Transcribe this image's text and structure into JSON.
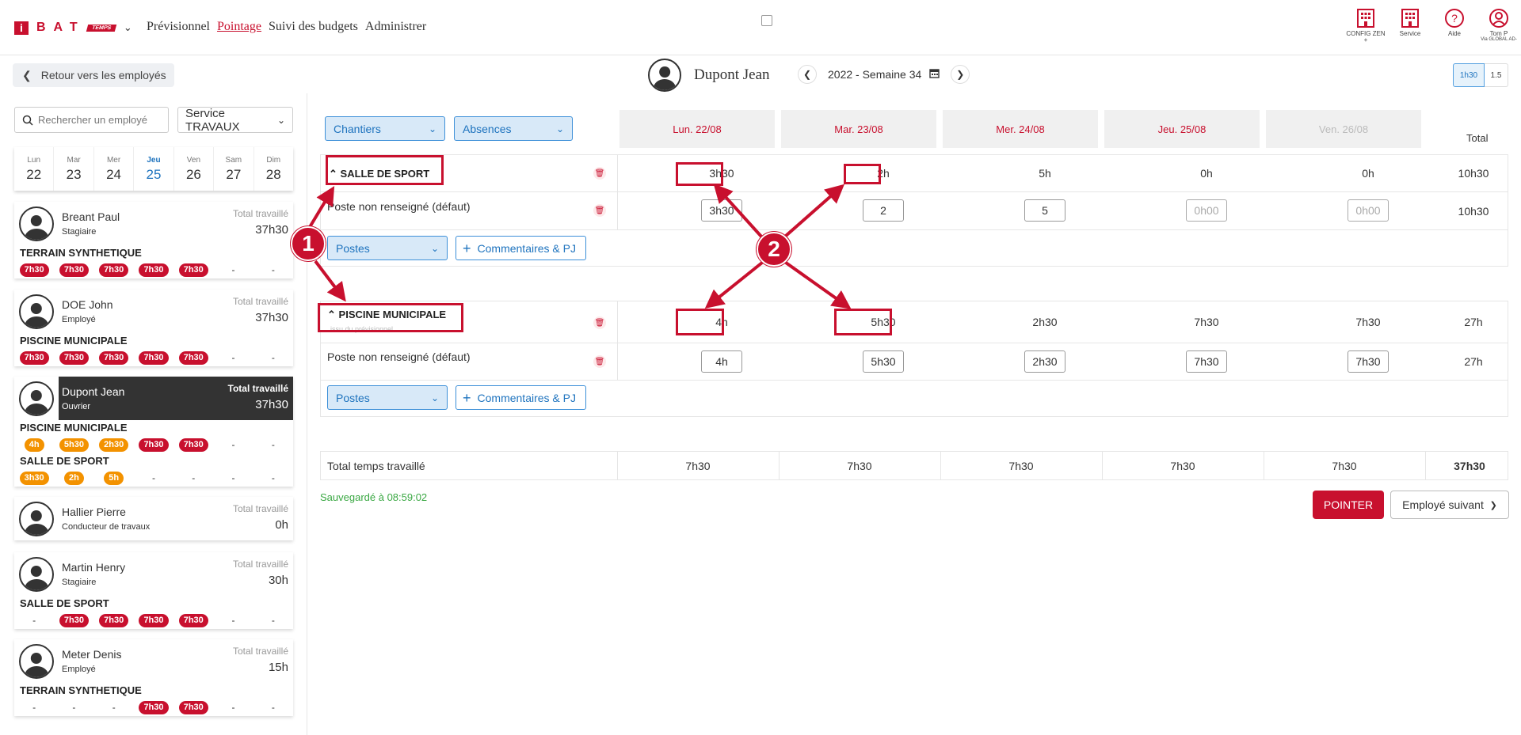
{
  "brand": {
    "i": "i",
    "bat": "BAT",
    "temps": "TEMPS"
  },
  "nav": [
    {
      "label": "Prévisionnel"
    },
    {
      "label": "Pointage"
    },
    {
      "label": "Suivi des budgets"
    },
    {
      "label": "Administrer"
    }
  ],
  "top_icons": [
    {
      "label": "CONFIG ZEN +",
      "icon": "building-icon"
    },
    {
      "label": "Service",
      "icon": "building-icon"
    },
    {
      "label": "Aide",
      "icon": "help-icon"
    },
    {
      "label": "Tom P",
      "sub": "Via GLOBAL AD-",
      "icon": "user-icon"
    }
  ],
  "back_label": "Retour vers les employés",
  "employee_name": "Dupont Jean",
  "week_label": "2022 - Semaine 34",
  "toggle": {
    "on": "1h30",
    "off": "1.5"
  },
  "search_placeholder": "Rechercher un employé",
  "service_select": "Service TRAVAUX",
  "days": [
    {
      "name": "Lun",
      "num": "22"
    },
    {
      "name": "Mar",
      "num": "23"
    },
    {
      "name": "Mer",
      "num": "24"
    },
    {
      "name": "Jeu",
      "num": "25"
    },
    {
      "name": "Ven",
      "num": "26"
    },
    {
      "name": "Sam",
      "num": "27"
    },
    {
      "name": "Dim",
      "num": "28"
    }
  ],
  "total_label": "Total travaillé",
  "employees": [
    {
      "name": "Breant Paul",
      "role": "Stagiaire",
      "total": "37h30",
      "sites": [
        {
          "name": "TERRAIN SYNTHETIQUE",
          "cells": [
            "7h30",
            "7h30",
            "7h30",
            "7h30",
            "7h30",
            "-",
            "-"
          ],
          "color": "red"
        }
      ]
    },
    {
      "name": "DOE John",
      "role": "Employé",
      "total": "37h30",
      "sites": [
        {
          "name": "PISCINE MUNICIPALE",
          "cells": [
            "7h30",
            "7h30",
            "7h30",
            "7h30",
            "7h30",
            "-",
            "-"
          ],
          "color": "red"
        }
      ]
    },
    {
      "name": "Dupont Jean",
      "role": "Ouvrier",
      "total": "37h30",
      "sites": [
        {
          "name": "PISCINE MUNICIPALE",
          "cells": [
            "4h",
            "5h30",
            "2h30",
            "7h30",
            "7h30",
            "-",
            "-"
          ],
          "colors": [
            "orange",
            "orange",
            "orange",
            "red",
            "red"
          ]
        },
        {
          "name": "SALLE DE SPORT",
          "cells": [
            "3h30",
            "2h",
            "5h",
            "-",
            "-",
            "-",
            "-"
          ],
          "color": "orange"
        }
      ]
    },
    {
      "name": "Hallier Pierre",
      "role": "Conducteur de travaux",
      "total": "0h",
      "sites": []
    },
    {
      "name": "Martin Henry",
      "role": "Stagiaire",
      "total": "30h",
      "sites": [
        {
          "name": "SALLE DE SPORT",
          "cells": [
            "-",
            "7h30",
            "7h30",
            "7h30",
            "7h30",
            "-",
            "-"
          ],
          "color": "red"
        }
      ]
    },
    {
      "name": "Meter Denis",
      "role": "Employé",
      "total": "15h",
      "sites": [
        {
          "name": "TERRAIN SYNTHETIQUE",
          "cells": [
            "-",
            "-",
            "-",
            "7h30",
            "7h30",
            "-",
            "-"
          ],
          "color": "red"
        }
      ]
    }
  ],
  "filters": {
    "chantiers": "Chantiers",
    "absences": "Absences"
  },
  "day_headers": [
    "Lun. 22/08",
    "Mar. 23/08",
    "Mer. 24/08",
    "Jeu. 25/08",
    "Ven. 26/08"
  ],
  "total_header": "Total",
  "blocks": [
    {
      "title": "SALLE DE SPORT",
      "subtitle": "",
      "values": [
        "3h30",
        "2h",
        "5h",
        "0h",
        "0h"
      ],
      "total": "10h30",
      "poste_label": "Poste non renseigné (défaut)",
      "inputs": [
        "3h30",
        "2",
        "5",
        "",
        ""
      ],
      "input_placeholder": "0h00",
      "poste_total": "10h30"
    },
    {
      "title": "PISCINE MUNICIPALE",
      "subtitle": "issu du prévisionnel",
      "values": [
        "4h",
        "5h30",
        "2h30",
        "7h30",
        "7h30"
      ],
      "total": "27h",
      "poste_label": "Poste non renseigné (défaut)",
      "inputs": [
        "4h",
        "5h30",
        "2h30",
        "7h30",
        "7h30"
      ],
      "input_placeholder": "0h00",
      "poste_total": "27h"
    }
  ],
  "postes_label": "Postes",
  "comments_label": "Commentaires & PJ",
  "total_row": {
    "label": "Total temps travaillé",
    "values": [
      "7h30",
      "7h30",
      "7h30",
      "7h30",
      "7h30"
    ],
    "total": "37h30"
  },
  "saved_text": "Sauvegardé à 08:59:02",
  "pointer_label": "POINTER",
  "next_label": "Employé suivant",
  "annotations": [
    {
      "label": "1"
    },
    {
      "label": "2"
    }
  ],
  "colors": {
    "brand": "#c8102e",
    "accent": "#1e73be",
    "orange": "#f39200",
    "saved": "#3aa843"
  }
}
